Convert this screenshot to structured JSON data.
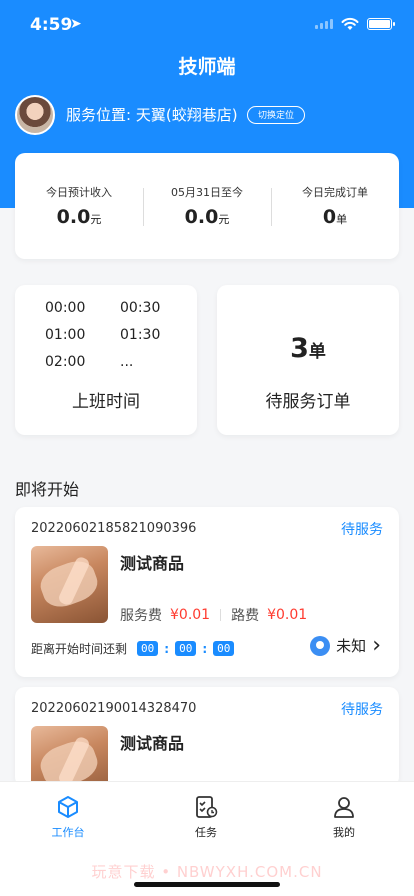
{
  "status_bar": {
    "time": "4:59"
  },
  "header": {
    "title": "技师端",
    "location_label": "服务位置:",
    "location_value": "天翼(蛟翔巷店)",
    "switch_label": "切换定位"
  },
  "stats": [
    {
      "label": "今日预计收入",
      "value": "0.0",
      "unit": "元"
    },
    {
      "label": "05月31日至今",
      "value": "0.0",
      "unit": "元"
    },
    {
      "label": "今日完成订单",
      "value": "0",
      "unit": "单"
    }
  ],
  "shift": {
    "times": [
      "00:00",
      "00:30",
      "01:00",
      "01:30",
      "02:00",
      "..."
    ],
    "title": "上班时间"
  },
  "pending": {
    "count": "3",
    "unit": "单",
    "title": "待服务订单"
  },
  "section_title": "即将开始",
  "orders": [
    {
      "order_no": "20220602185821090396",
      "status": "待服务",
      "product": "测试商品",
      "service_fee_label": "服务费",
      "service_fee": "¥0.01",
      "travel_fee_label": "路费",
      "travel_fee": "¥0.01",
      "countdown_label": "距离开始时间还剩",
      "countdown": [
        "00",
        "00",
        "00"
      ],
      "location": "未知"
    },
    {
      "order_no": "20220602190014328470",
      "status": "待服务",
      "product": "测试商品"
    }
  ],
  "tabbar": [
    {
      "label": "工作台",
      "icon": "cube-icon",
      "active": true
    },
    {
      "label": "任务",
      "icon": "task-clipboard-icon",
      "active": false
    },
    {
      "label": "我的",
      "icon": "person-icon",
      "active": false
    }
  ],
  "watermark": "玩意下载 • NBWYXH.COM.CN",
  "colors": {
    "primary": "#1a8cff",
    "price": "#ff3b30"
  }
}
